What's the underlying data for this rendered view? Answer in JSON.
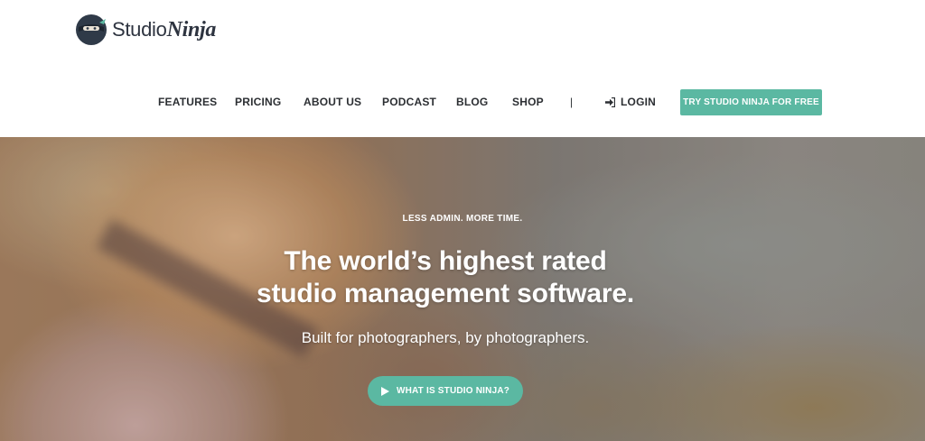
{
  "header": {
    "logo": {
      "studio": "Studio",
      "ninja": "Ninja"
    },
    "nav": [
      {
        "label": "FEATURES"
      },
      {
        "label": "PRICING"
      },
      {
        "label": "ABOUT US"
      },
      {
        "label": "PODCAST"
      },
      {
        "label": "BLOG"
      },
      {
        "label": "SHOP"
      }
    ],
    "separator": "|",
    "login_label": "LOGIN",
    "cta_label": "TRY STUDIO NINJA FOR FREE"
  },
  "hero": {
    "tagline": "LESS ADMIN. MORE TIME.",
    "headline_line1": "The world’s highest rated",
    "headline_line2": "studio management software.",
    "subheadline": "Built for photographers, by photographers.",
    "cta_label": "WHAT IS STUDIO NINJA?"
  },
  "colors": {
    "accent": "#5bb8a2",
    "nav_text": "#2c2f33",
    "logo_text": "#2e3440"
  },
  "icons": [
    "ninja-logo-icon",
    "login-icon",
    "play-icon"
  ]
}
